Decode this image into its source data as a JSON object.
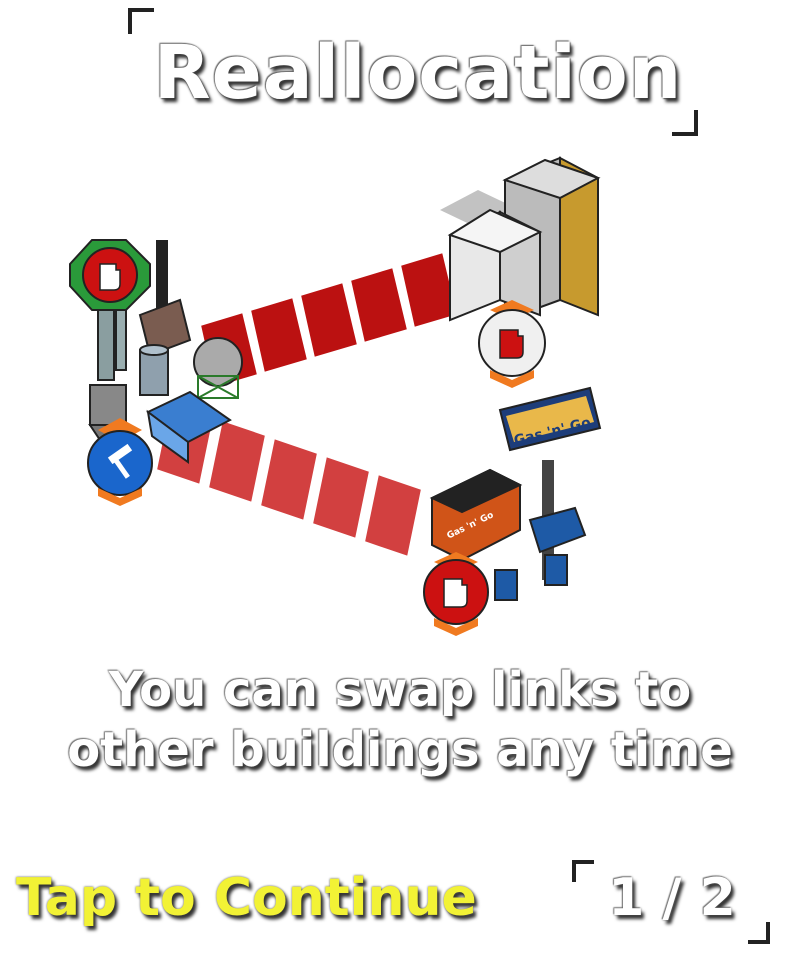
{
  "title": "Reallocation",
  "scene": {
    "signs": [
      {
        "name": "gas-station-sign",
        "text": "Gas 'n' Go"
      },
      {
        "name": "gas-station-roof-sign",
        "text": "Gas 'n' Go"
      }
    ],
    "icons": {
      "refinery_top": "fuel-nozzle-icon",
      "refinery_bottom": "hammer-icon",
      "city": "fuel-nozzle-icon",
      "gas_station": "fuel-nozzle-icon"
    },
    "colors": {
      "link_upper": "#bb1111",
      "link_lower": "#d24040",
      "icon_green": "#2a9a3a",
      "icon_red": "#cc1111",
      "icon_blue": "#1a66cc",
      "icon_white": "#f0f0f0",
      "chevron": "#f07a20"
    }
  },
  "message": {
    "line1": "You can swap links to",
    "line2": "other buildings any time"
  },
  "footer": {
    "continue_label": "Tap to Continue",
    "page_indicator": "1 / 2"
  }
}
